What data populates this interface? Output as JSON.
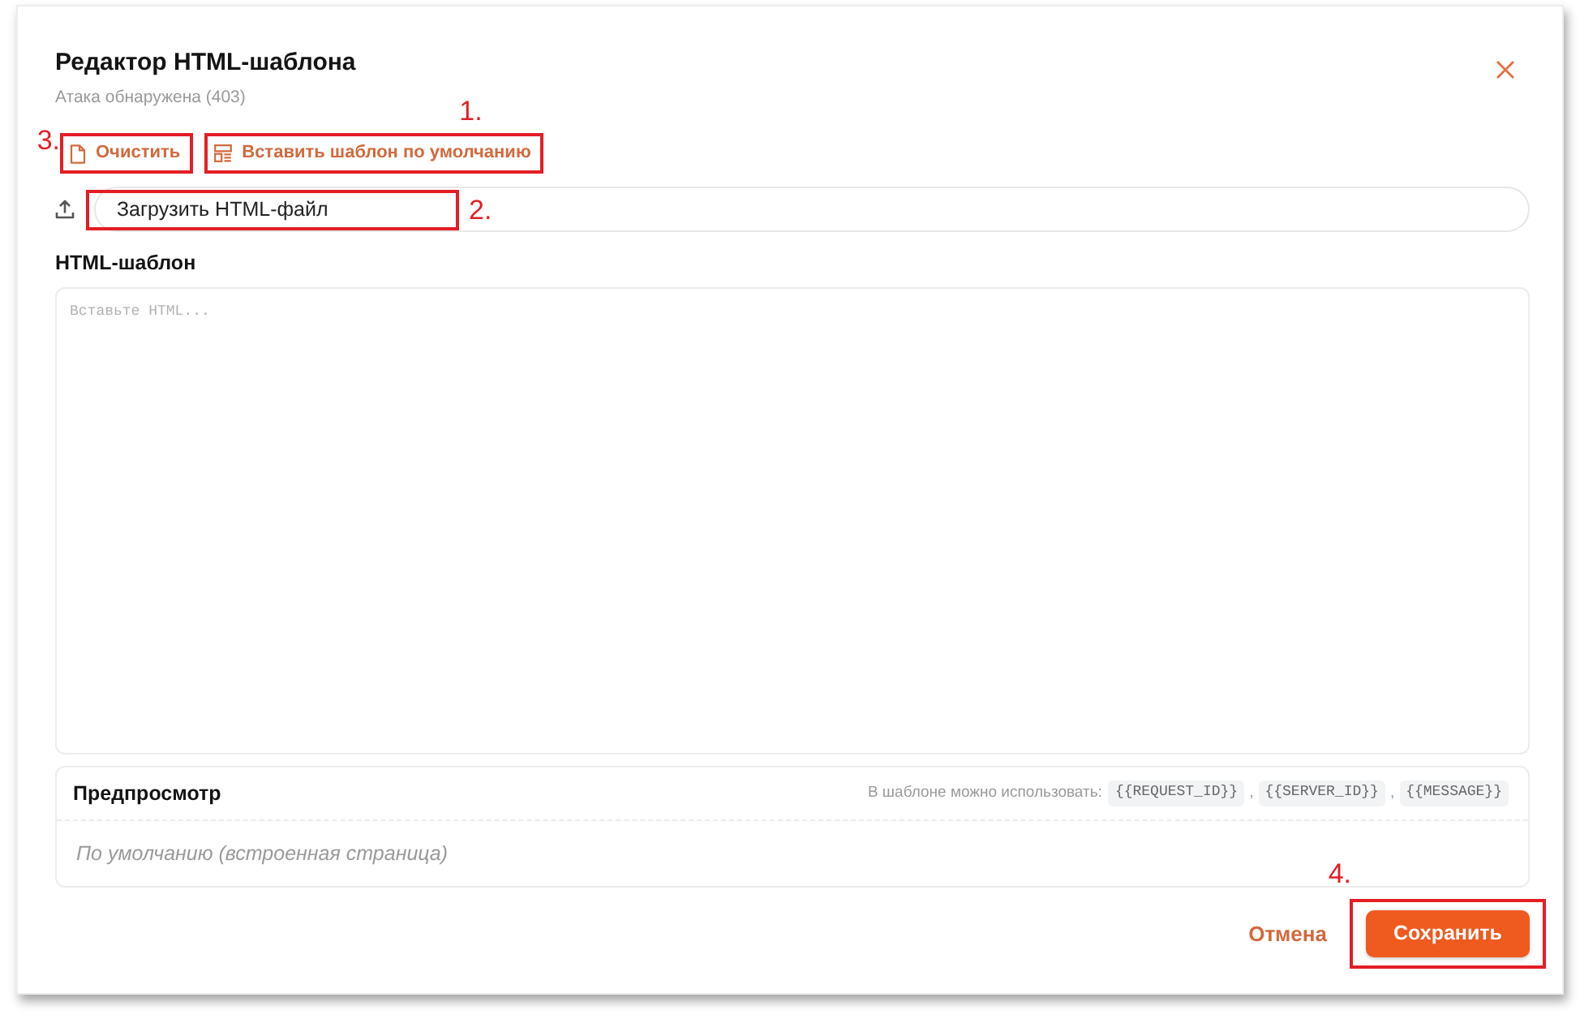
{
  "dialog": {
    "title": "Редактор HTML-шаблона",
    "subtitle": "Атака обнаружена (403)"
  },
  "toolbar": [
    {
      "label": "Очистить",
      "kind": "clear",
      "callout": "3."
    },
    {
      "label": "Вставить шаблон по умолчанию",
      "kind": "template",
      "callout": "1."
    }
  ],
  "upload": {
    "label": "Загрузить HTML-файл",
    "callout": "2."
  },
  "editor": {
    "label": "HTML-шаблон",
    "placeholder": "Вставьте HTML..."
  },
  "preview": {
    "title": "Предпросмотр",
    "hint": "В шаблоне можно использовать:",
    "variables": [
      {
        "text": "{{REQUEST_ID}}",
        "kind": "code"
      },
      {
        "text": ",",
        "kind": "plain"
      },
      {
        "text": "{{SERVER_ID}}",
        "kind": "code"
      },
      {
        "text": ",",
        "kind": "plain"
      },
      {
        "text": "{{MESSAGE}}",
        "kind": "code"
      }
    ],
    "body": "По умолчанию (встроенная страница)"
  },
  "footer": {
    "buttons": [
      {
        "label": "Отмена",
        "kind": "link"
      },
      {
        "label": "Сохранить",
        "kind": "primary",
        "callout": "4."
      }
    ]
  }
}
